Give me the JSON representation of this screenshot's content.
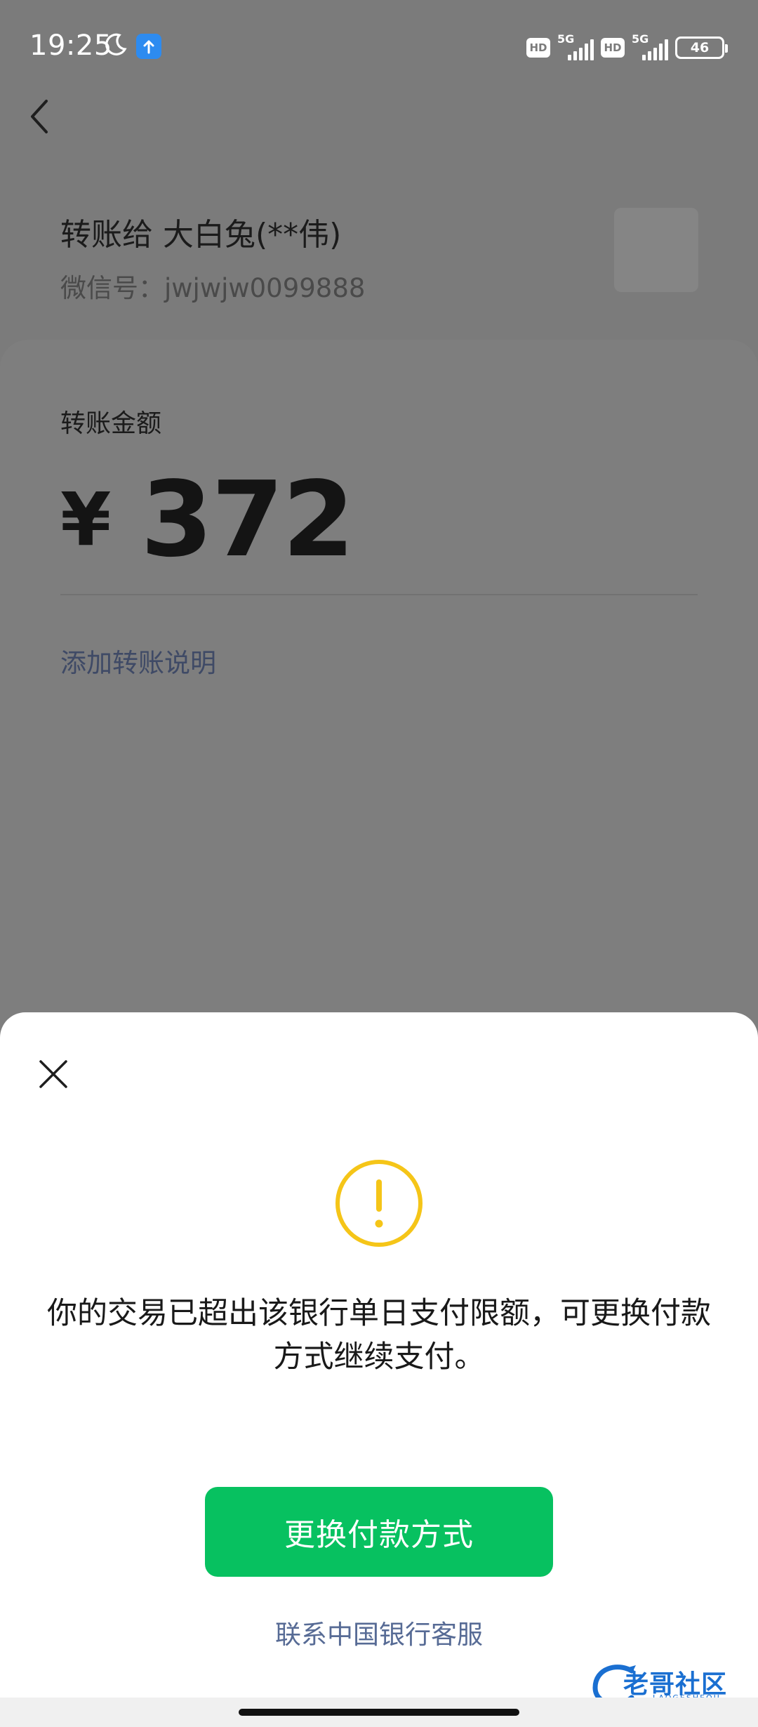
{
  "status_bar": {
    "time": "19:25",
    "network_1": "5G",
    "network_2": "5G",
    "hd_label": "HD",
    "battery": "46"
  },
  "payee": {
    "name": "转账给 大白兔(**伟)",
    "wechat_id": "微信号：jwjwjw0099888"
  },
  "transfer": {
    "amount_label": "转账金额",
    "currency_symbol": "¥",
    "amount": "372",
    "add_note": "添加转账说明"
  },
  "dialog": {
    "message": "你的交易已超出该银行单日支付限额，可更换付款方式继续支付。",
    "primary_button": "更换付款方式",
    "secondary_link": "联系中国银行客服",
    "icon": "warning-icon"
  },
  "watermark": {
    "text": "老哥社区",
    "subtext": "LAOGESHEQU"
  },
  "colors": {
    "primary_green": "#07c160",
    "link_blue": "#576b95",
    "warning_yellow": "#f5c518"
  }
}
